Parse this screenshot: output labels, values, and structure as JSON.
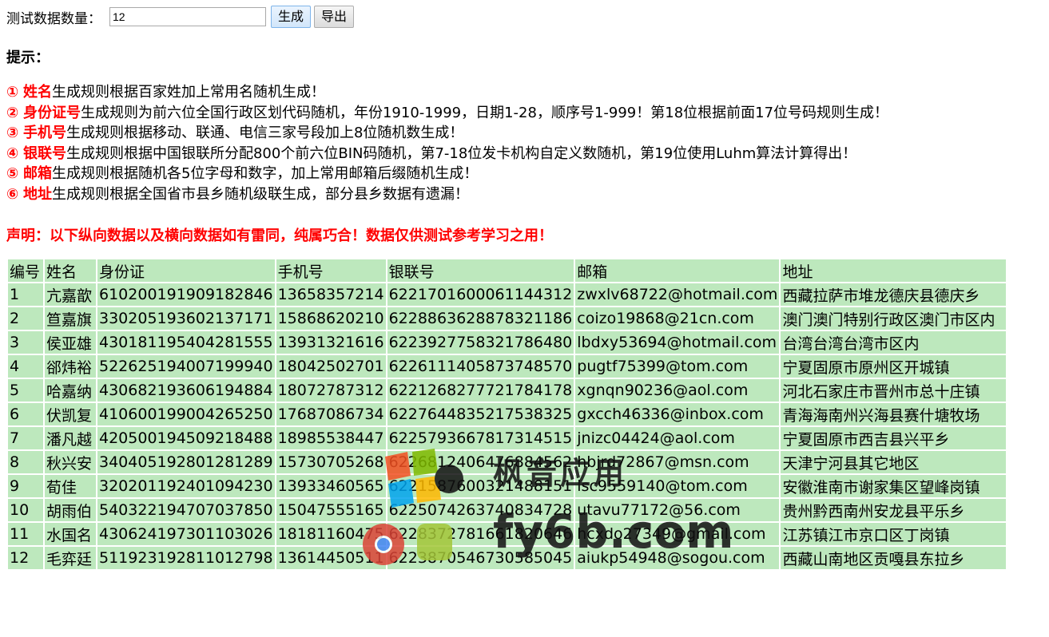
{
  "form": {
    "count_label": "测试数据数量：",
    "count_value": "12",
    "generate_label": "生成",
    "export_label": "导出"
  },
  "tips": {
    "title": "提示：",
    "items": [
      {
        "num": "①",
        "key": "姓名",
        "text": "生成规则根据百家姓加上常用名随机生成！"
      },
      {
        "num": "②",
        "key": "身份证号",
        "text": "生成规则为前六位全国行政区划代码随机，年份1910-1999，日期1-28，顺序号1-999！第18位根据前面17位号码规则生成！"
      },
      {
        "num": "③",
        "key": "手机号",
        "text": "生成规则根据移动、联通、电信三家号段加上8位随机数生成！"
      },
      {
        "num": "④",
        "key": "银联号",
        "text": "生成规则根据中国银联所分配800个前六位BIN码随机，第7-18位发卡机构自定义数随机，第19位使用Luhm算法计算得出！"
      },
      {
        "num": "⑤",
        "key": "邮箱",
        "text": "生成规则根据随机各5位字母和数字，加上常用邮箱后缀随机生成！"
      },
      {
        "num": "⑥",
        "key": "地址",
        "text": "生成规则根据全国省市县乡随机级联生成，部分县乡数据有遗漏！"
      }
    ],
    "notice": "声明：以下纵向数据以及横向数据如有雷同，纯属巧合！数据仅供测试参考学习之用！"
  },
  "table": {
    "headers": [
      "编号",
      "姓名",
      "身份证",
      "手机号",
      "银联号",
      "邮箱",
      "地址"
    ],
    "rows": [
      [
        "1",
        "亢嘉歆",
        "610200191909182846",
        "13658357214",
        "6221701600061144312",
        "zwxlv68722@hotmail.com",
        "西藏拉萨市堆龙德庆县德庆乡"
      ],
      [
        "2",
        "笪嘉旗",
        "330205193602137171",
        "15868620210",
        "6228863628878321186",
        "coizo19868@21cn.com",
        "澳门澳门特别行政区澳门市区内"
      ],
      [
        "3",
        "侯亚雄",
        "430181195404281555",
        "13931321616",
        "6223927758321786480",
        "lbdxy53694@hotmail.com",
        "台湾台湾台湾市区内"
      ],
      [
        "4",
        "郤炜裕",
        "522625194007199940",
        "18042502701",
        "6226111405873748570",
        "pugtf75399@tom.com",
        "宁夏固原市原州区开城镇"
      ],
      [
        "5",
        "哈嘉纳",
        "430682193606194884",
        "18072787312",
        "6221268277721784178",
        "xgnqn90236@aol.com",
        "河北石家庄市晋州市总十庄镇"
      ],
      [
        "6",
        "伏凯复",
        "410600199004265250",
        "17687086734",
        "6227644835217538325",
        "gxcch46336@inbox.com",
        "青海海南州兴海县赛什塘牧场"
      ],
      [
        "7",
        "潘凡越",
        "420500194509218488",
        "18985538447",
        "6225793667817314515",
        "jnizc04424@aol.com",
        "宁夏固原市西吉县兴平乡"
      ],
      [
        "8",
        "秋兴安",
        "340405192801281289",
        "15730705268",
        "6226812406476884562",
        "hbjrd72867@msn.com",
        "天津宁河县其它地区"
      ],
      [
        "9",
        "荀佳",
        "320201192401094230",
        "13933460565",
        "6221587600321488151",
        "lsc9559140@tom.com",
        "安徽淮南市谢家集区望峰岗镇"
      ],
      [
        "10",
        "胡雨伯",
        "540322194707037850",
        "15047555165",
        "6225074263740834728",
        "utavu77172@56.com",
        "贵州黔西南州安龙县平乐乡"
      ],
      [
        "11",
        "水国名",
        "430624197301103026",
        "18181160475",
        "6228372781661820646",
        "hcxdo27349@gmail.com",
        "江苏镇江市京口区丁岗镇"
      ],
      [
        "12",
        "毛弈廷",
        "511923192811012798",
        "13614450511",
        "6223870546730585045",
        "aiukp54948@sogou.com",
        "西藏山南地区贡嘎县东拉乡"
      ]
    ]
  },
  "watermark": {
    "line1": "枫音应用",
    "line2": "fy6b.com"
  },
  "colors": {
    "highlight_red": "#ff0000",
    "table_cell_bg": "#bde8bd"
  }
}
